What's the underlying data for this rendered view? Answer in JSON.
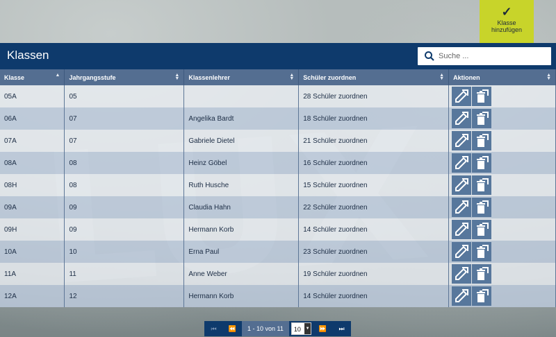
{
  "add_button": {
    "label_line1": "Klasse",
    "label_line2": "hinzufügen"
  },
  "header": {
    "title": "Klassen"
  },
  "search": {
    "placeholder": "Suche ..."
  },
  "table": {
    "columns": [
      "Klasse",
      "Jahrgangsstufe",
      "Klassenlehrer",
      "Schüler zuordnen",
      "Aktionen"
    ],
    "rows": [
      [
        "05A",
        "05",
        "",
        "28 Schüler zuordnen"
      ],
      [
        "06A",
        "07",
        "Angelika Bardt",
        "18 Schüler zuordnen"
      ],
      [
        "07A",
        "07",
        "Gabriele Dietel",
        "21 Schüler zuordnen"
      ],
      [
        "08A",
        "08",
        "Heinz Göbel",
        "16 Schüler zuordnen"
      ],
      [
        "08H",
        "08",
        "Ruth Husche",
        "15 Schüler zuordnen"
      ],
      [
        "09A",
        "09",
        "Claudia Hahn",
        "22 Schüler zuordnen"
      ],
      [
        "09H",
        "09",
        "Hermann Korb",
        "14 Schüler zuordnen"
      ],
      [
        "10A",
        "10",
        "Erna Paul",
        "23 Schüler zuordnen"
      ],
      [
        "11A",
        "11",
        "Anne Weber",
        "19 Schüler zuordnen"
      ],
      [
        "12A",
        "12",
        "Hermann Korb",
        "14 Schüler zuordnen"
      ]
    ]
  },
  "pagination": {
    "info": "1 - 10 von 11",
    "page_size": "10"
  },
  "icons": {
    "edit": "edit-icon",
    "delete": "delete-icon",
    "search": "search-icon"
  },
  "colors": {
    "header": "#0e3a6c",
    "accent": "#c8d42a",
    "table_header": "#546e91"
  }
}
